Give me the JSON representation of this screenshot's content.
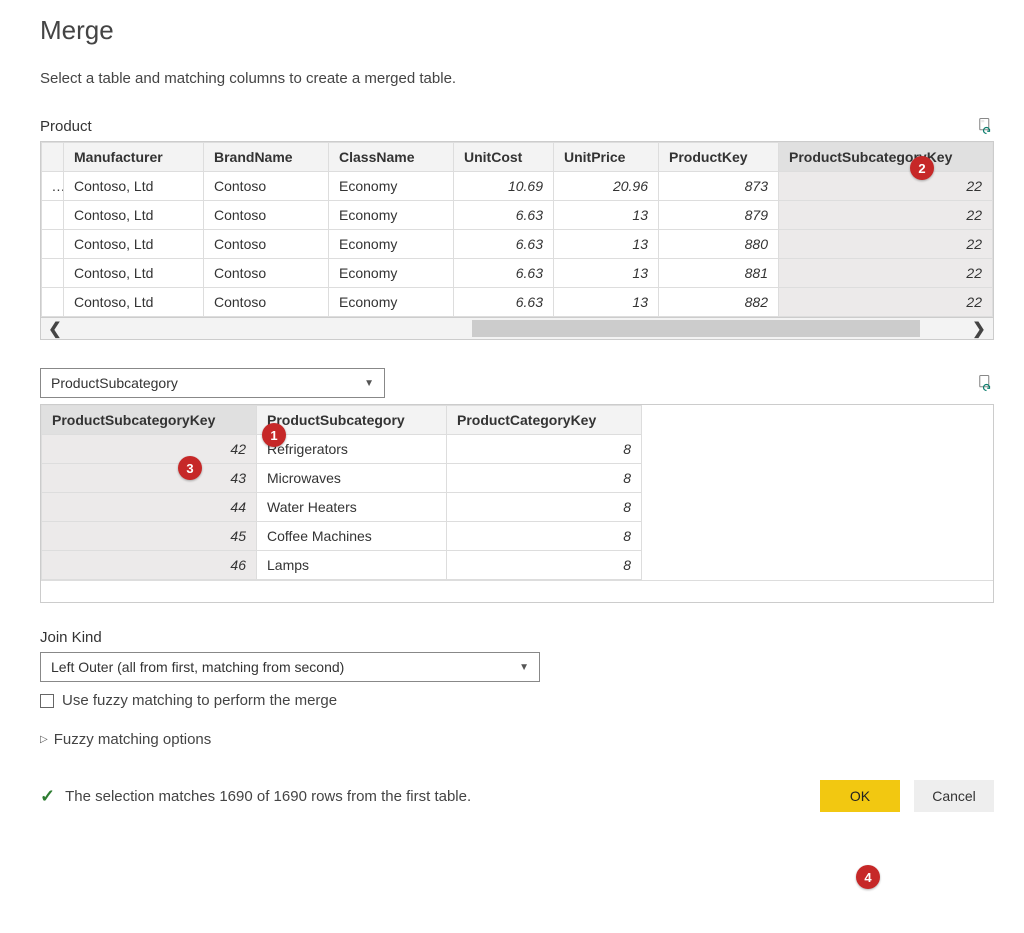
{
  "dialog": {
    "title": "Merge",
    "subtitle": "Select a table and matching columns to create a merged table."
  },
  "table1": {
    "name": "Product",
    "columns": [
      "Manufacturer",
      "BrandName",
      "ClassName",
      "UnitCost",
      "UnitPrice",
      "ProductKey",
      "ProductSubcategoryKey"
    ],
    "rows": [
      {
        "Manufacturer": "Contoso, Ltd",
        "BrandName": "Contoso",
        "ClassName": "Economy",
        "UnitCost": "10.69",
        "UnitPrice": "20.96",
        "ProductKey": "873",
        "ProductSubcategoryKey": "22"
      },
      {
        "Manufacturer": "Contoso, Ltd",
        "BrandName": "Contoso",
        "ClassName": "Economy",
        "UnitCost": "6.63",
        "UnitPrice": "13",
        "ProductKey": "879",
        "ProductSubcategoryKey": "22"
      },
      {
        "Manufacturer": "Contoso, Ltd",
        "BrandName": "Contoso",
        "ClassName": "Economy",
        "UnitCost": "6.63",
        "UnitPrice": "13",
        "ProductKey": "880",
        "ProductSubcategoryKey": "22"
      },
      {
        "Manufacturer": "Contoso, Ltd",
        "BrandName": "Contoso",
        "ClassName": "Economy",
        "UnitCost": "6.63",
        "UnitPrice": "13",
        "ProductKey": "881",
        "ProductSubcategoryKey": "22"
      },
      {
        "Manufacturer": "Contoso, Ltd",
        "BrandName": "Contoso",
        "ClassName": "Economy",
        "UnitCost": "6.63",
        "UnitPrice": "13",
        "ProductKey": "882",
        "ProductSubcategoryKey": "22"
      }
    ]
  },
  "table2": {
    "selected_name": "ProductSubcategory",
    "columns": [
      "ProductSubcategoryKey",
      "ProductSubcategory",
      "ProductCategoryKey"
    ],
    "rows": [
      {
        "ProductSubcategoryKey": "42",
        "ProductSubcategory": "Refrigerators",
        "ProductCategoryKey": "8"
      },
      {
        "ProductSubcategoryKey": "43",
        "ProductSubcategory": "Microwaves",
        "ProductCategoryKey": "8"
      },
      {
        "ProductSubcategoryKey": "44",
        "ProductSubcategory": "Water Heaters",
        "ProductCategoryKey": "8"
      },
      {
        "ProductSubcategoryKey": "45",
        "ProductSubcategory": "Coffee Machines",
        "ProductCategoryKey": "8"
      },
      {
        "ProductSubcategoryKey": "46",
        "ProductSubcategory": "Lamps",
        "ProductCategoryKey": "8"
      }
    ]
  },
  "join": {
    "label": "Join Kind",
    "selected": "Left Outer (all from first, matching from second)"
  },
  "fuzzy": {
    "checkbox_label": "Use fuzzy matching to perform the merge",
    "expander_label": "Fuzzy matching options"
  },
  "status": {
    "text": "The selection matches 1690 of 1690 rows from the first table."
  },
  "buttons": {
    "ok": "OK",
    "cancel": "Cancel"
  },
  "callouts": {
    "c1": "1",
    "c2": "2",
    "c3": "3",
    "c4": "4"
  }
}
